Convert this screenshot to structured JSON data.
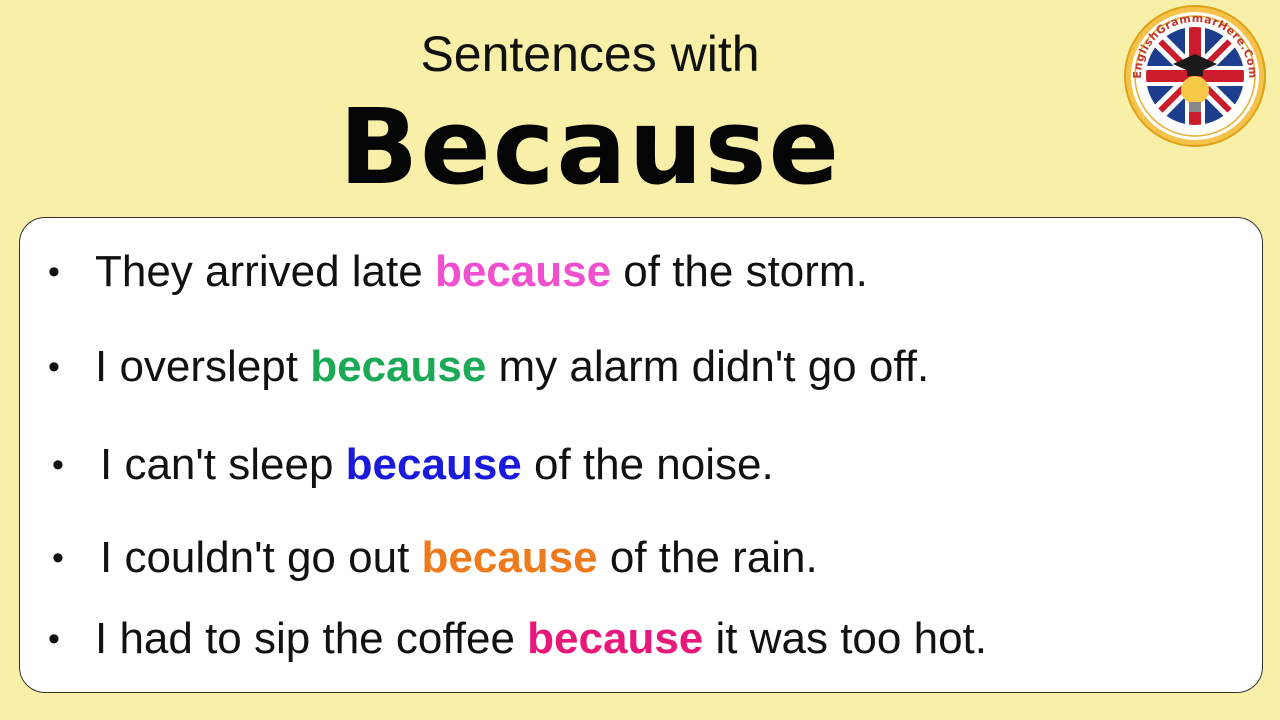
{
  "header": {
    "subtitle": "Sentences with",
    "title": "Because"
  },
  "logo": {
    "text": "EnglishGrammarHere.Com",
    "icon": "union-jack-graduation-lightbulb-icon"
  },
  "bullet_glyph": "•",
  "sentences": [
    {
      "before": "They arrived late ",
      "keyword": "because",
      "after": " of the storm.",
      "keyword_color": "#f04fd0"
    },
    {
      "before": "I overslept ",
      "keyword": "because",
      "after": " my alarm didn't go off.",
      "keyword_color": "#1aaa55"
    },
    {
      "before": "I can't sleep ",
      "keyword": "because",
      "after": " of the noise.",
      "keyword_color": "#1a1adc"
    },
    {
      "before": "I couldn't go out ",
      "keyword": "because",
      "after": " of the rain.",
      "keyword_color": "#ee7a1c"
    },
    {
      "before": "I had to sip the coffee ",
      "keyword": "because",
      "after": " it was too hot.",
      "keyword_color": "#e8187a"
    }
  ]
}
